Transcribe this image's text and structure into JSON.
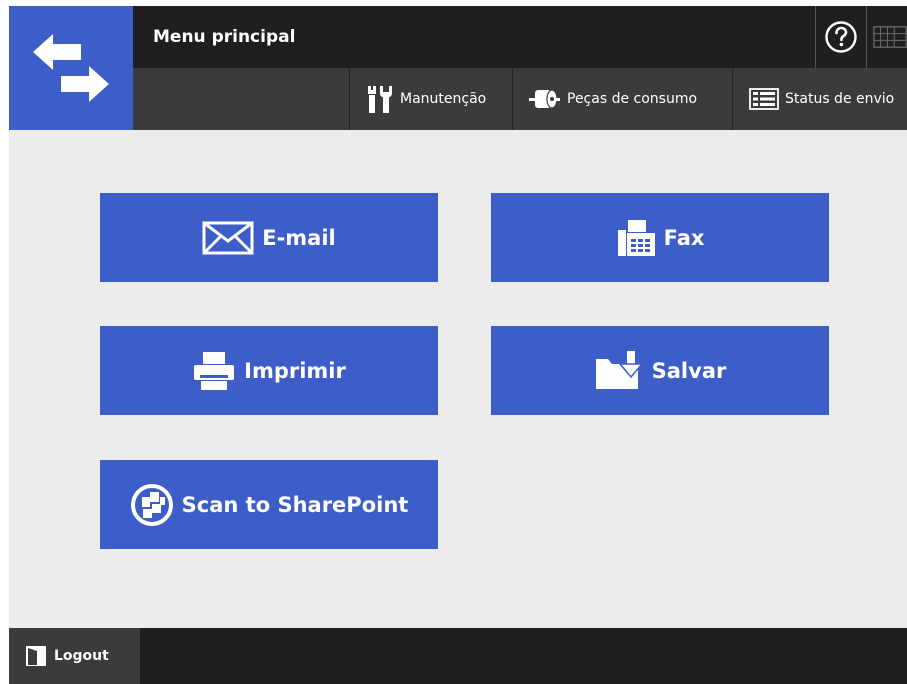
{
  "header": {
    "title": "Menu principal",
    "logo_icon": "swap-arrows-icon",
    "help_icon": "help-icon",
    "keyboard_icon": "keyboard-icon"
  },
  "toolbar": {
    "maintenance": {
      "label": "Manutenção",
      "icon": "tools-icon"
    },
    "consumables": {
      "label": "Peças de consumo",
      "icon": "paper-roll-icon"
    },
    "send_status": {
      "label": "Status de envio",
      "icon": "status-list-icon"
    }
  },
  "actions": {
    "email": {
      "label": "E-mail",
      "icon": "envelope-icon"
    },
    "fax": {
      "label": "Fax",
      "icon": "fax-icon"
    },
    "print": {
      "label": "Imprimir",
      "icon": "printer-icon"
    },
    "save": {
      "label": "Salvar",
      "icon": "folder-save-icon"
    },
    "sharepoint": {
      "label": "Scan to SharePoint",
      "icon": "sharepoint-icon"
    }
  },
  "footer": {
    "logout_label": "Logout",
    "logout_icon": "logout-icon"
  },
  "colors": {
    "accent": "#3d5ec9",
    "header_dark": "#1f1f1f",
    "toolbar": "#3b3b3b",
    "background": "#ececec"
  }
}
